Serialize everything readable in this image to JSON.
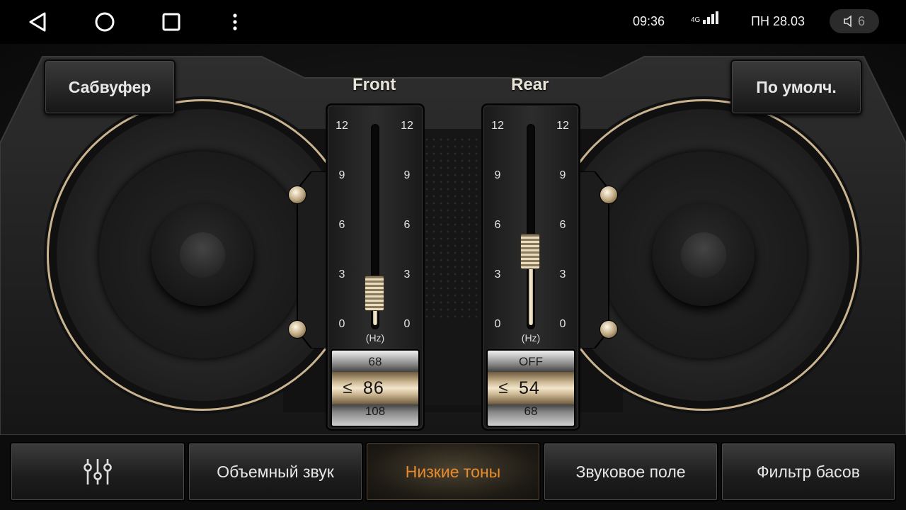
{
  "status": {
    "time": "09:36",
    "network": "4G",
    "date": "ПН 28.03",
    "volume": "6"
  },
  "nav": {
    "back_icon": "back-triangle-icon",
    "home_icon": "home-circle-icon",
    "recents_icon": "recents-square-icon",
    "menu_icon": "more-vert-icon"
  },
  "top_buttons": {
    "left": "Сабвуфер",
    "right": "По умолч."
  },
  "channels": [
    {
      "title": "Front",
      "scale": [
        "12",
        "9",
        "6",
        "3",
        "0"
      ],
      "unit": "(Hz)",
      "level": 0.16,
      "wheel": {
        "prev": "68",
        "current": "86",
        "next": "108"
      }
    },
    {
      "title": "Rear",
      "scale": [
        "12",
        "9",
        "6",
        "3",
        "0"
      ],
      "unit": "(Hz)",
      "level": 0.37,
      "wheel": {
        "prev": "OFF",
        "current": "54",
        "next": "68"
      }
    }
  ],
  "wheel_arrow": "≤",
  "tabs": [
    {
      "label": "",
      "icon": "equalizer-sliders-icon"
    },
    {
      "label": "Объемный звук"
    },
    {
      "label": "Низкие тоны",
      "active": true
    },
    {
      "label": "Звуковое поле"
    },
    {
      "label": "Фильтр басов"
    }
  ],
  "colors": {
    "accent": "#e88b2a",
    "gold": "#c9b48f"
  }
}
